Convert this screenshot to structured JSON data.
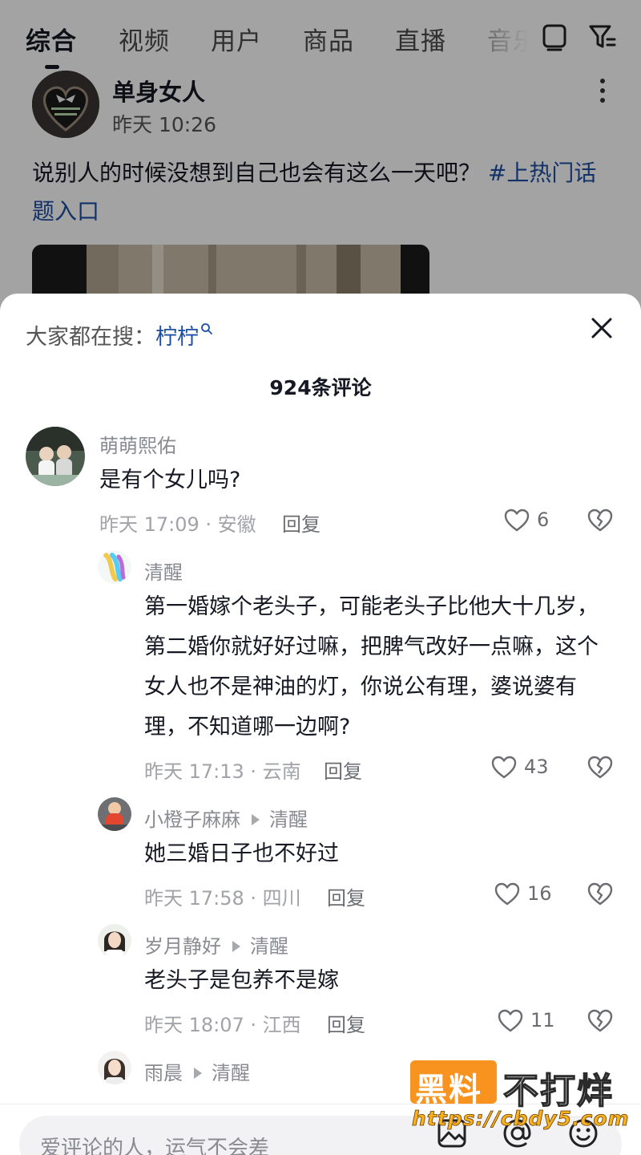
{
  "tabs": [
    {
      "label": "综合",
      "active": true
    },
    {
      "label": "视频"
    },
    {
      "label": "用户"
    },
    {
      "label": "商品"
    },
    {
      "label": "直播"
    },
    {
      "label": "音乐"
    }
  ],
  "top_icons": [
    "tablet-icon",
    "filter-icon"
  ],
  "post": {
    "author": "单身女人",
    "time": "昨天 10:26",
    "text": "说别人的时候没想到自己也会有这么一天吧？",
    "hashtag": "#上热门话题入口"
  },
  "sheet": {
    "hot_search_label": "大家都在搜：",
    "hot_search_keyword": "柠柠",
    "title": "924条评论"
  },
  "comments": [
    {
      "name": "萌萌熙佑",
      "text": "是有个女儿吗?",
      "meta": "昨天 17:09 · 安徽",
      "reply": "回复",
      "likes": "6"
    },
    {
      "name": "清醒",
      "text": "第一婚嫁个老头子，可能老头子比他大十几岁，第二婚你就好好过嘛，把脾气改好一点嘛，这个女人也不是神油的灯，你说公有理，婆说婆有理，不知道哪一边啊?",
      "meta": "昨天 17:13 · 云南",
      "reply": "回复",
      "likes": "43"
    },
    {
      "name": "小橙子麻麻",
      "reply_to": "清醒",
      "text": "她三婚日子也不好过",
      "meta": "昨天 17:58 · 四川",
      "reply": "回复",
      "likes": "16"
    },
    {
      "name": "岁月静好",
      "reply_to": "清醒",
      "text": "老头子是包养不是嫁",
      "meta": "昨天 18:07 · 江西",
      "reply": "回复",
      "likes": "11"
    },
    {
      "name": "雨晨",
      "reply_to": "清醒"
    }
  ],
  "input": {
    "placeholder": "爱评论的人，运气不会差",
    "icons": [
      "image-icon",
      "at-icon",
      "emoji-icon"
    ]
  },
  "watermark": {
    "box_text": "黑料",
    "side_text": "不打烊",
    "url": "https://cbdy5.com"
  },
  "colors": {
    "accent_blue": "#1d4fa3",
    "watermark_orange": "#f7931e"
  }
}
